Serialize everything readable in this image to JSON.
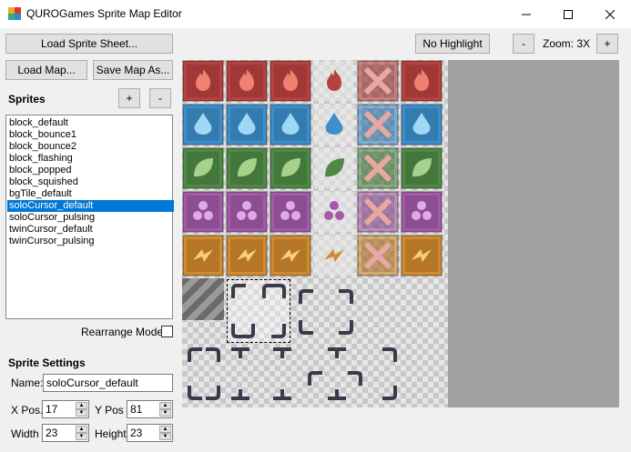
{
  "window": {
    "title": "QUROGames Sprite Map Editor"
  },
  "toolbar": {
    "load_sprite_sheet": "Load Sprite Sheet...",
    "load_map": "Load Map...",
    "save_map_as": "Save Map As...",
    "no_highlight": "No Highlight",
    "zoom_minus": "-",
    "zoom_label": "Zoom: 3X",
    "zoom_plus": "+"
  },
  "sprites": {
    "heading": "Sprites",
    "add": "+",
    "remove": "-",
    "items": [
      "block_default",
      "block_bounce1",
      "block_bounce2",
      "block_flashing",
      "block_popped",
      "block_squished",
      "bgTile_default",
      "soloCursor_default",
      "soloCursor_pulsing",
      "twinCursor_default",
      "twinCursor_pulsing"
    ],
    "selected": "soloCursor_default",
    "rearrange_label": "Rearrange Mode",
    "rearrange_checked": false
  },
  "settings": {
    "heading": "Sprite Settings",
    "name_label": "Name:",
    "name_value": "soloCursor_default",
    "xpos_label": "X Pos.",
    "xpos_value": "17",
    "ypos_label": "Y Pos",
    "ypos_value": "81",
    "width_label": "Width",
    "width_value": "23",
    "height_label": "Height",
    "height_value": "23"
  },
  "colors": {
    "selection": "#0078d7",
    "fire_row": "#b8413f",
    "water_row": "#3d8fcc",
    "leaf_row": "#4f8a45",
    "berry_row": "#a35aa8",
    "bolt_row": "#d18a2e",
    "cursor_outline": "#3a3a4a"
  },
  "rows": [
    {
      "kind": "fire",
      "color": "#b8413f",
      "icon": "#f08070",
      "cells": [
        "flame-icon",
        "flame-icon",
        "flame-icon",
        "flame-icon",
        "x-mark-icon",
        "flame-icon"
      ]
    },
    {
      "kind": "water",
      "color": "#3d8fcc",
      "icon": "#9fd8f5",
      "cells": [
        "droplet-icon",
        "droplet-icon",
        "droplet-icon",
        "droplet-icon",
        "x-mark-icon",
        "droplet-icon"
      ]
    },
    {
      "kind": "leaf",
      "color": "#4f8a45",
      "icon": "#a6d28c",
      "cells": [
        "leaf-icon",
        "leaf-icon",
        "leaf-icon",
        "leaf-icon",
        "x-mark-icon",
        "leaf-icon"
      ]
    },
    {
      "kind": "berry",
      "color": "#a35aa8",
      "icon": "#e0a8e6",
      "cells": [
        "berry-icon",
        "berry-icon",
        "berry-icon",
        "berry-icon",
        "x-mark-icon",
        "berry-icon"
      ]
    },
    {
      "kind": "bolt",
      "color": "#d18a2e",
      "icon": "#f7cf7a",
      "cells": [
        "bolt-icon",
        "bolt-icon",
        "bolt-icon",
        "bolt-icon",
        "x-mark-icon",
        "bolt-icon"
      ]
    }
  ]
}
